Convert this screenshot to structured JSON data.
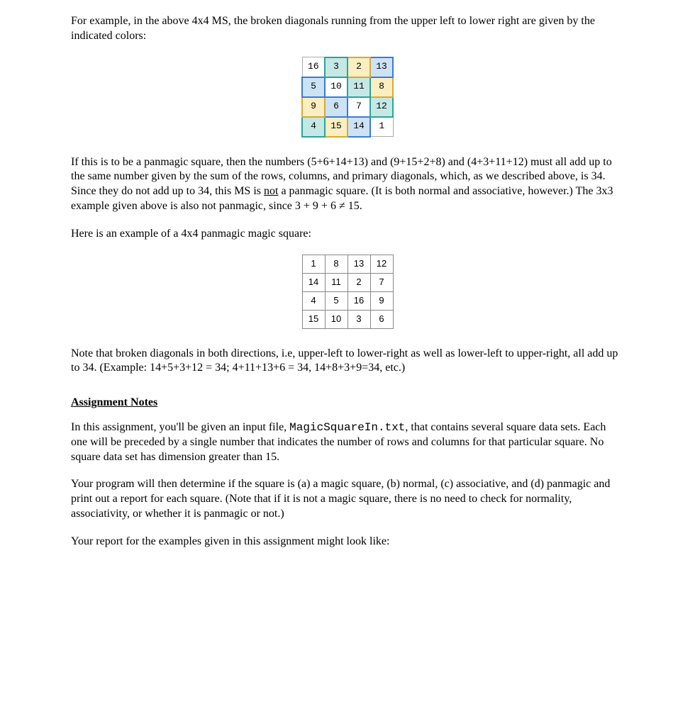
{
  "para1": "For example, in the above 4x4 MS, the broken diagonals running from the upper left to lower right are given by the indicated colors:",
  "grid1": [
    [
      "16",
      "3",
      "2",
      "13"
    ],
    [
      "5",
      "10",
      "11",
      "8"
    ],
    [
      "9",
      "6",
      "7",
      "12"
    ],
    [
      "4",
      "15",
      "14",
      "1"
    ]
  ],
  "para2_a": "If this is to be a panmagic square, then the numbers (5+6+14+13) and (9+15+2+8) and (4+3+11+12) must all add up to the same number given by the sum of the rows, columns, and primary diagonals, which, as we described above, is 34.  Since they do not add up to 34, this MS is ",
  "para2_not": "not",
  "para2_b": " a panmagic square.  (It is both normal and associative, however.)  The 3x3 example given above is also not panmagic, since 3 + 9 + 6 ≠ 15.",
  "para3": "Here is an example of a 4x4 panmagic magic square:",
  "grid2": [
    [
      "1",
      "8",
      "13",
      "12"
    ],
    [
      "14",
      "11",
      "2",
      "7"
    ],
    [
      "4",
      "5",
      "16",
      "9"
    ],
    [
      "15",
      "10",
      "3",
      "6"
    ]
  ],
  "para4": "Note that broken diagonals in both directions, i.e, upper-left to lower-right as well as lower-left to upper-right, all add up to 34.  (Example:  14+5+3+12 = 34; 4+11+13+6 = 34, 14+8+3+9=34, etc.)",
  "sectionTitle": "Assignment Notes",
  "para5_a": "In this assignment, you'll be given an input file, ",
  "para5_file": "MagicSquareIn.txt",
  "para5_b": ", that contains several square data sets.  Each one will be preceded by a single number that indicates the number of rows and columns for that particular square.  No square data set has dimension greater than 15.",
  "para6": "Your program will then determine if the square is (a) a magic square, (b) normal, (c) associative, and (d) panmagic and print out a report for each square.  (Note that if it is not a magic square, there is no need to check for normality, associativity, or whether it is panmagic or not.)",
  "para7": "Your report for the examples given in this assignment might look like:"
}
